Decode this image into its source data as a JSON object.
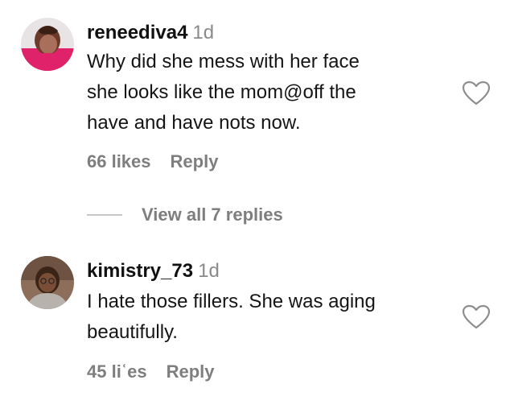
{
  "comments": [
    {
      "username": "reneediva4",
      "time": "1d",
      "lines": [
        "Why did she mess with her face",
        "she looks like the mom@off the",
        "have and have nots now."
      ],
      "likes": "66 likes",
      "reply_label": "Reply",
      "like_icon": "heart-outline-icon",
      "avatar_color": "#e0226b"
    },
    {
      "username": "kimistry_73",
      "time": "1d",
      "lines": [
        "I hate those fillers. She was aging",
        "beautifully."
      ],
      "likes": "45 liʿes",
      "reply_label": "Reply",
      "like_icon": "heart-outline-icon",
      "avatar_color": "#8a5a3c"
    }
  ],
  "view_replies": {
    "label": "View all 7 replies"
  },
  "colors": {
    "username": "#111111",
    "secondary_text": "#7e7e7e",
    "timestamp": "#8a8a8a",
    "divider": "#c7c7c7"
  }
}
